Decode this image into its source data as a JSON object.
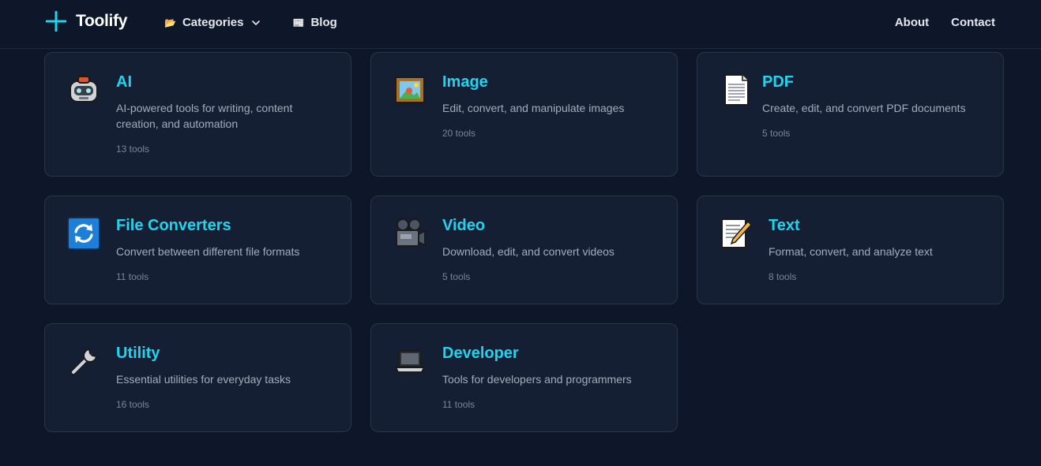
{
  "brand": {
    "name": "Toolify"
  },
  "nav": {
    "categories_label": "Categories",
    "categories_emoji": "📂",
    "blog_label": "Blog",
    "blog_emoji": "📰",
    "about_label": "About",
    "contact_label": "Contact"
  },
  "colors": {
    "background": "#0e1629",
    "card": "#141f33",
    "accent": "#22d3ee"
  },
  "categories": [
    {
      "title": "AI",
      "icon": "robot-icon",
      "description": "AI-powered tools for writing, content creation, and automation",
      "count": "13 tools"
    },
    {
      "title": "Image",
      "icon": "framed-picture-icon",
      "description": "Edit, convert, and manipulate images",
      "count": "20 tools"
    },
    {
      "title": "PDF",
      "icon": "document-icon",
      "description": "Create, edit, and convert PDF documents",
      "count": "5 tools"
    },
    {
      "title": "File Converters",
      "icon": "refresh-icon",
      "description": "Convert between different file formats",
      "count": "11 tools"
    },
    {
      "title": "Video",
      "icon": "movie-camera-icon",
      "description": "Download, edit, and convert videos",
      "count": "5 tools"
    },
    {
      "title": "Text",
      "icon": "memo-icon",
      "description": "Format, convert, and analyze text",
      "count": "8 tools"
    },
    {
      "title": "Utility",
      "icon": "wrench-icon",
      "description": "Essential utilities for everyday tasks",
      "count": "16 tools"
    },
    {
      "title": "Developer",
      "icon": "laptop-icon",
      "description": "Tools for developers and programmers",
      "count": "11 tools"
    }
  ]
}
